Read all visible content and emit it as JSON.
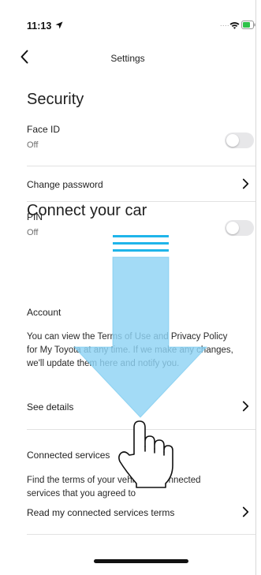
{
  "status_bar": {
    "time": "11:13",
    "signal": "....",
    "icons": [
      "location-arrow-icon",
      "wifi-icon",
      "battery-icon"
    ]
  },
  "nav": {
    "title": "Settings",
    "back_icon": "chevron-left-icon"
  },
  "security": {
    "title": "Security",
    "face_id": {
      "label": "Face ID",
      "value": "Off",
      "enabled": false
    },
    "change_password": {
      "label": "Change password"
    },
    "pin": {
      "label": "PIN",
      "value": "Off",
      "enabled": false
    }
  },
  "connect": {
    "title": "Connect your car",
    "account": {
      "heading": "Account",
      "description_lines": [
        "You can view the Terms of Use and Privacy Policy",
        "for My Toyota at any time. If we make any changes,",
        "we'll update them here and notify you."
      ],
      "see_details": "See details"
    },
    "connected_services": {
      "heading": "Connected services",
      "description_lines": [
        "Find the terms of your vehicle(s) connected",
        "services that you agreed to"
      ],
      "read_terms": "Read my connected services terms"
    }
  },
  "gesture_hint": {
    "direction": "down",
    "icon": "swipe-down-hand-icon"
  },
  "colors": {
    "gesture": "#8fd3f4",
    "gesture_stripes": "#1fb5ea",
    "toggle_off": "#e7e7e9"
  }
}
